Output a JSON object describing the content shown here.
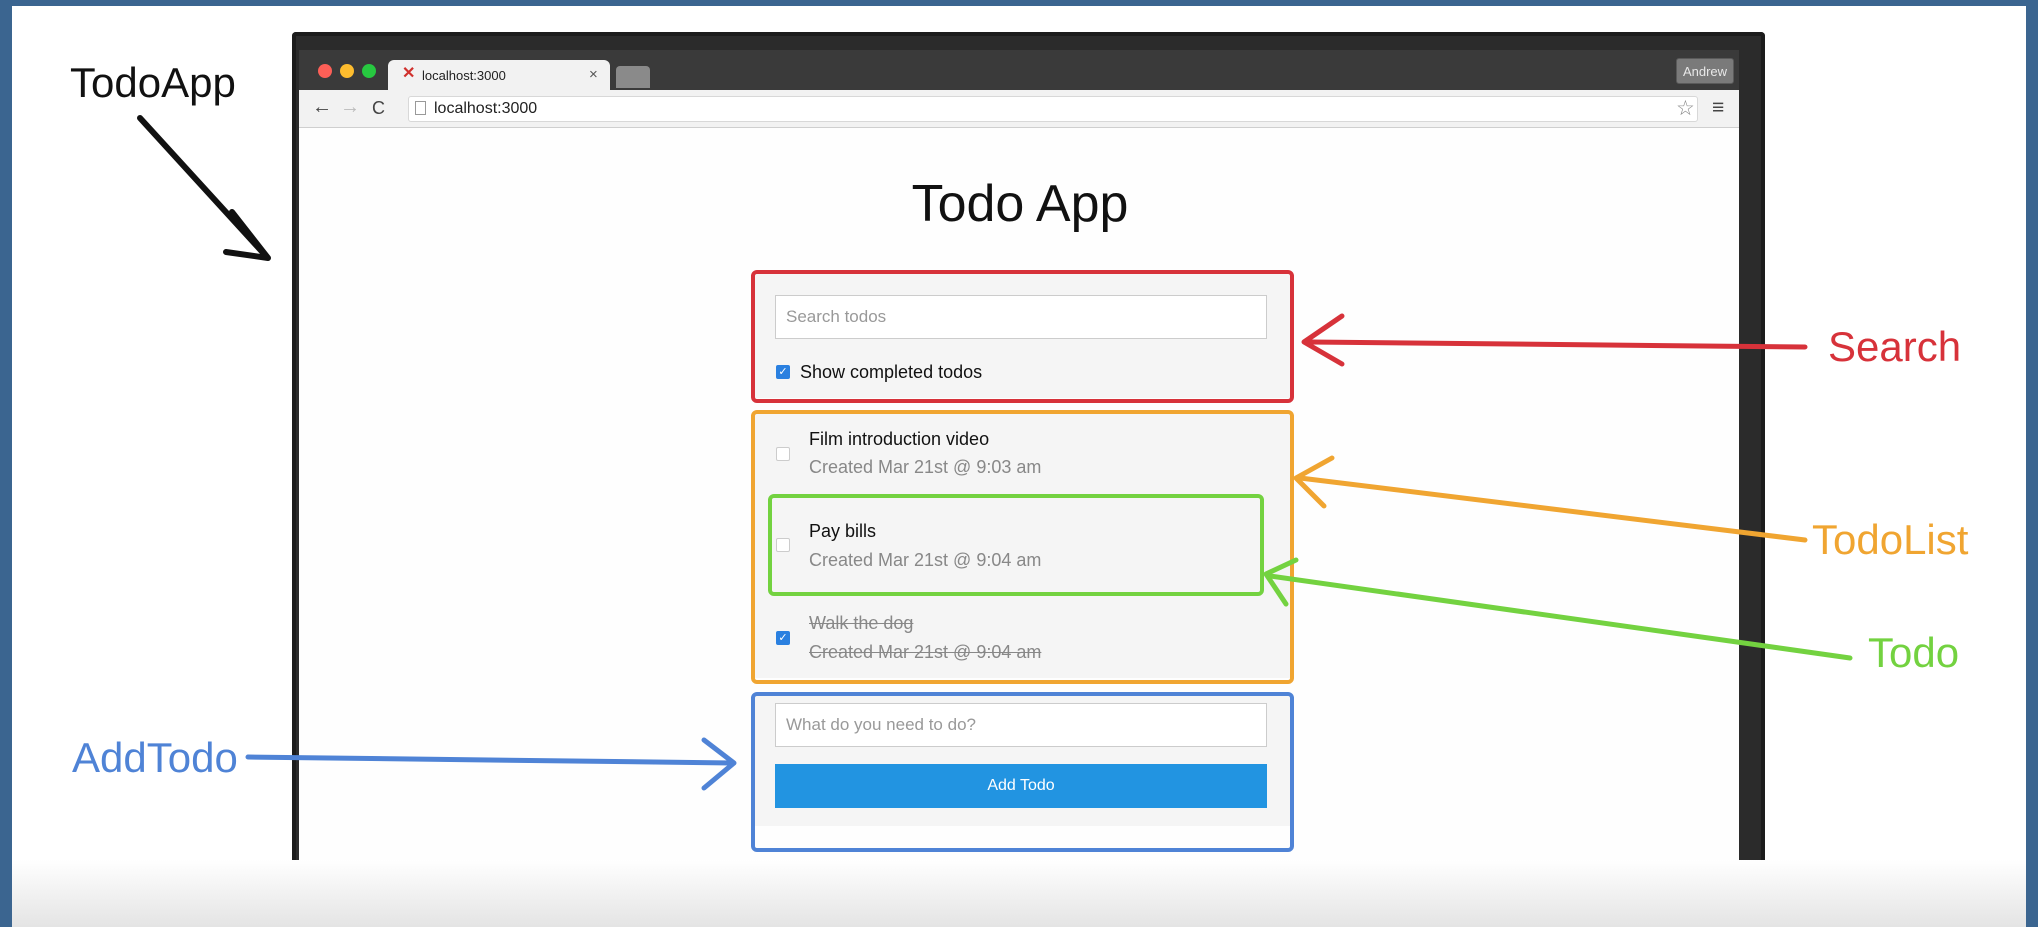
{
  "annotations": {
    "todo_app": "TodoApp",
    "search": "Search",
    "todo_list": "TodoList",
    "todo": "Todo",
    "add_todo": "AddTodo"
  },
  "colors": {
    "search": "#d7323a",
    "todo_list": "#f0a531",
    "todo": "#73d240",
    "add_todo": "#4f83d6",
    "button": "#2294e1",
    "checkbox": "#2a80e0"
  },
  "browser": {
    "tab_title": "localhost:3000",
    "url": "localhost:3000",
    "profile": "Andrew"
  },
  "app": {
    "title": "Todo App",
    "search_placeholder": "Search todos",
    "show_completed_label": "Show completed todos",
    "show_completed_checked": true,
    "todos": [
      {
        "text": "Film introduction video",
        "created": "Created Mar 21st @ 9:03 am",
        "completed": false
      },
      {
        "text": "Pay bills",
        "created": "Created Mar 21st @ 9:04 am",
        "completed": false
      },
      {
        "text": "Walk the dog",
        "created": "Created Mar 21st @ 9:04 am",
        "completed": true
      }
    ],
    "add_placeholder": "What do you need to do?",
    "add_button": "Add Todo"
  }
}
